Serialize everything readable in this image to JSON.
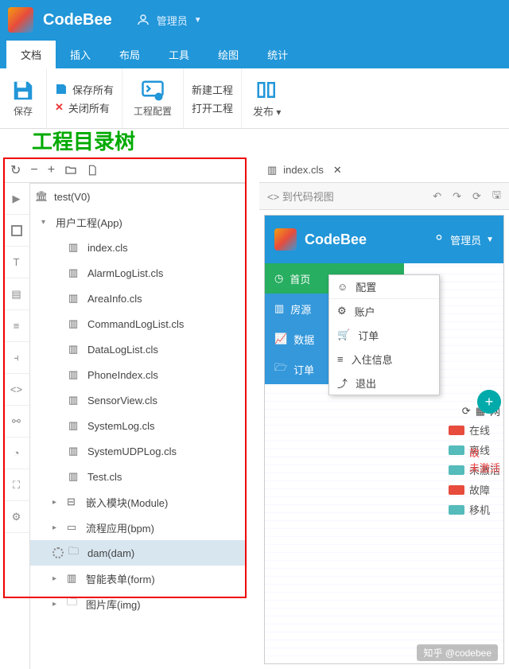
{
  "app": {
    "name": "CodeBee",
    "user_label": "管理员"
  },
  "menu": {
    "tabs": [
      "文档",
      "插入",
      "布局",
      "工具",
      "绘图",
      "统计"
    ],
    "active": 0
  },
  "toolbar": {
    "save": "保存",
    "save_all": "保存所有",
    "close_all": "关闭所有",
    "project_config": "工程配置",
    "new_project": "新建工程",
    "open_project": "打开工程",
    "publish": "发布"
  },
  "annotation": "工程目录树",
  "tree_toolbar": {
    "refresh": "C",
    "minus": "−",
    "plus": "+",
    "folder": "folder",
    "newfile": "newfile"
  },
  "tree": {
    "root": "test(V0)",
    "items": [
      {
        "label": "用户工程(App)",
        "expanded": true,
        "children": [
          "index.cls",
          "AlarmLogList.cls",
          "AreaInfo.cls",
          "CommandLogList.cls",
          "DataLogList.cls",
          "PhoneIndex.cls",
          "SensorView.cls",
          "SystemLog.cls",
          "SystemUDPLog.cls",
          "Test.cls"
        ]
      },
      {
        "label": "嵌入模块(Module)",
        "expanded": false
      },
      {
        "label": "流程应用(bpm)",
        "expanded": false
      },
      {
        "label": "dam(dam)",
        "expanded": false,
        "selected": true,
        "loading": true
      },
      {
        "label": "智能表单(form)",
        "expanded": false
      },
      {
        "label": "图片库(img)",
        "expanded": false
      }
    ]
  },
  "editor": {
    "filename": "index.cls",
    "code_view": "到代码视图"
  },
  "preview": {
    "brand": "CodeBee",
    "user": "管理员",
    "nav": [
      "首页",
      "房源",
      "数据",
      "订单"
    ],
    "dropdown": [
      "配置",
      "账户",
      "订单",
      "入住信息",
      "退出"
    ],
    "legend_title": "网",
    "legend": [
      {
        "label": "在线",
        "color": "#e74c3c"
      },
      {
        "label": "离线",
        "color": "#5bb"
      },
      {
        "label": "未激活",
        "color": "#5bb"
      },
      {
        "label": "故障",
        "color": "#e74c3c"
      },
      {
        "label": "移机",
        "color": "#5bb"
      }
    ],
    "red_hint": "故",
    "hint2": "未激活"
  },
  "watermark": "知乎 @codebee"
}
